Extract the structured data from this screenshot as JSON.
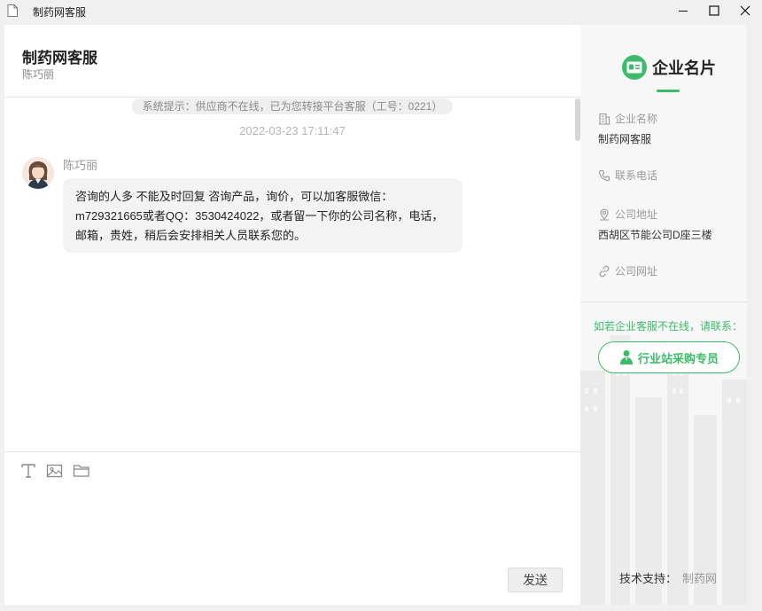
{
  "window": {
    "title": "制药网客服"
  },
  "chat": {
    "title": "制药网客服",
    "subtitle": "陈巧丽",
    "system_tip": "系统提示：供应商不在线，已为您转接平台客服（工号：0221）",
    "timestamp": "2022-03-23 17:11:47",
    "message": {
      "sender": "陈巧丽",
      "text": "咨询的人多 不能及时回复 咨询产品，询价，可以加客服微信：m729321665或者QQ：3530424022，或者留一下你的公司名称，电话，邮箱，贵姓，稍后会安排相关人员联系您的。"
    },
    "send_label": "发送"
  },
  "card": {
    "title": "企业名片",
    "company_name_label": "企业名称",
    "company_name": "制药网客服",
    "phone_label": "联系电话",
    "address_label": "公司地址",
    "address": "西胡区节能公司D座三楼",
    "website_label": "公司网址",
    "offline_tip": "如若企业客服不在线，请联系：",
    "buyer_button": "行业站采购专员",
    "support_label": "技术支持：",
    "support_link": "制药网"
  },
  "colors": {
    "accent": "#3dbb6a"
  }
}
